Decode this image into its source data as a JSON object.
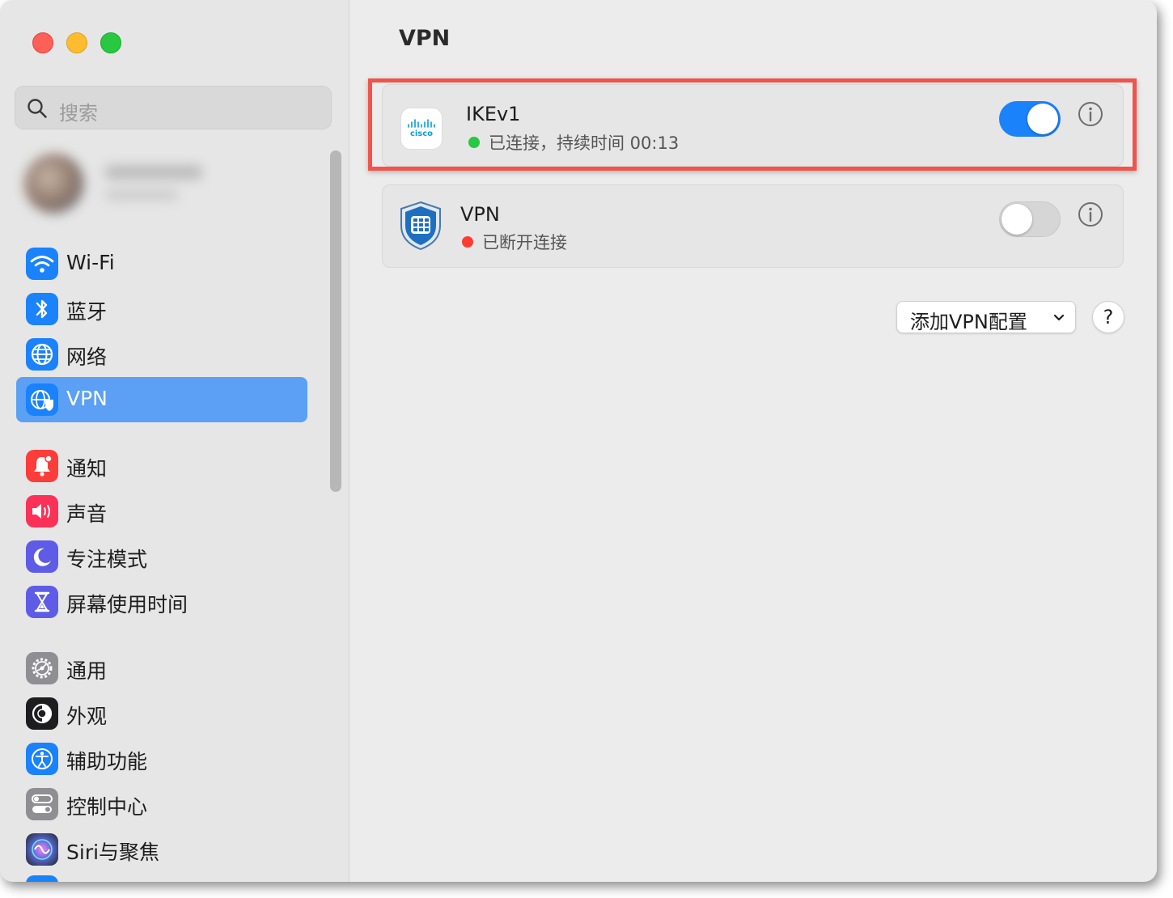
{
  "window_controls": {
    "close": "close",
    "minimize": "minimize",
    "zoom": "zoom"
  },
  "sidebar": {
    "search": {
      "placeholder": "搜索"
    },
    "items": [
      {
        "label": "Wi-Fi",
        "icon": "wifi-icon",
        "color": "#1a82fb"
      },
      {
        "label": "蓝牙",
        "icon": "bluetooth-icon",
        "color": "#1a82fb"
      },
      {
        "label": "网络",
        "icon": "globe-icon",
        "color": "#1a82fb"
      },
      {
        "label": "VPN",
        "icon": "vpn-globe-shield-icon",
        "color": "#1a82fb",
        "selected": true
      },
      {
        "label": "通知",
        "icon": "bell-icon",
        "color": "#fc3d39"
      },
      {
        "label": "声音",
        "icon": "speaker-icon",
        "color": "#fc3158"
      },
      {
        "label": "专注模式",
        "icon": "moon-icon",
        "color": "#5e5ce6"
      },
      {
        "label": "屏幕使用时间",
        "icon": "hourglass-icon",
        "color": "#5e5ce6"
      },
      {
        "label": "通用",
        "icon": "gear-icon",
        "color": "#8e8e93"
      },
      {
        "label": "外观",
        "icon": "appearance-icon",
        "color": "#1d1d1f"
      },
      {
        "label": "辅助功能",
        "icon": "accessibility-icon",
        "color": "#1a82fb"
      },
      {
        "label": "控制中心",
        "icon": "control-center-icon",
        "color": "#8e8e93"
      },
      {
        "label": "Siri与聚焦",
        "icon": "siri-icon",
        "color": "#3b3b55"
      }
    ]
  },
  "main": {
    "title": "VPN",
    "connections": [
      {
        "name": "IKEv1",
        "status": "已连接，持续时间 00:13",
        "status_color": "#28c840",
        "enabled": true,
        "logo": "cisco-logo",
        "logo_text": "cisco"
      },
      {
        "name": "VPN",
        "status": "已断开连接",
        "status_color": "#ff3b30",
        "enabled": false,
        "logo": "fortinet-shield-logo"
      }
    ],
    "add_button": "添加VPN配置",
    "help_button": "?"
  },
  "colors": {
    "accent": "#1a82fb",
    "selected_row": "#5ba0f4",
    "highlight_border": "#f0544a"
  }
}
